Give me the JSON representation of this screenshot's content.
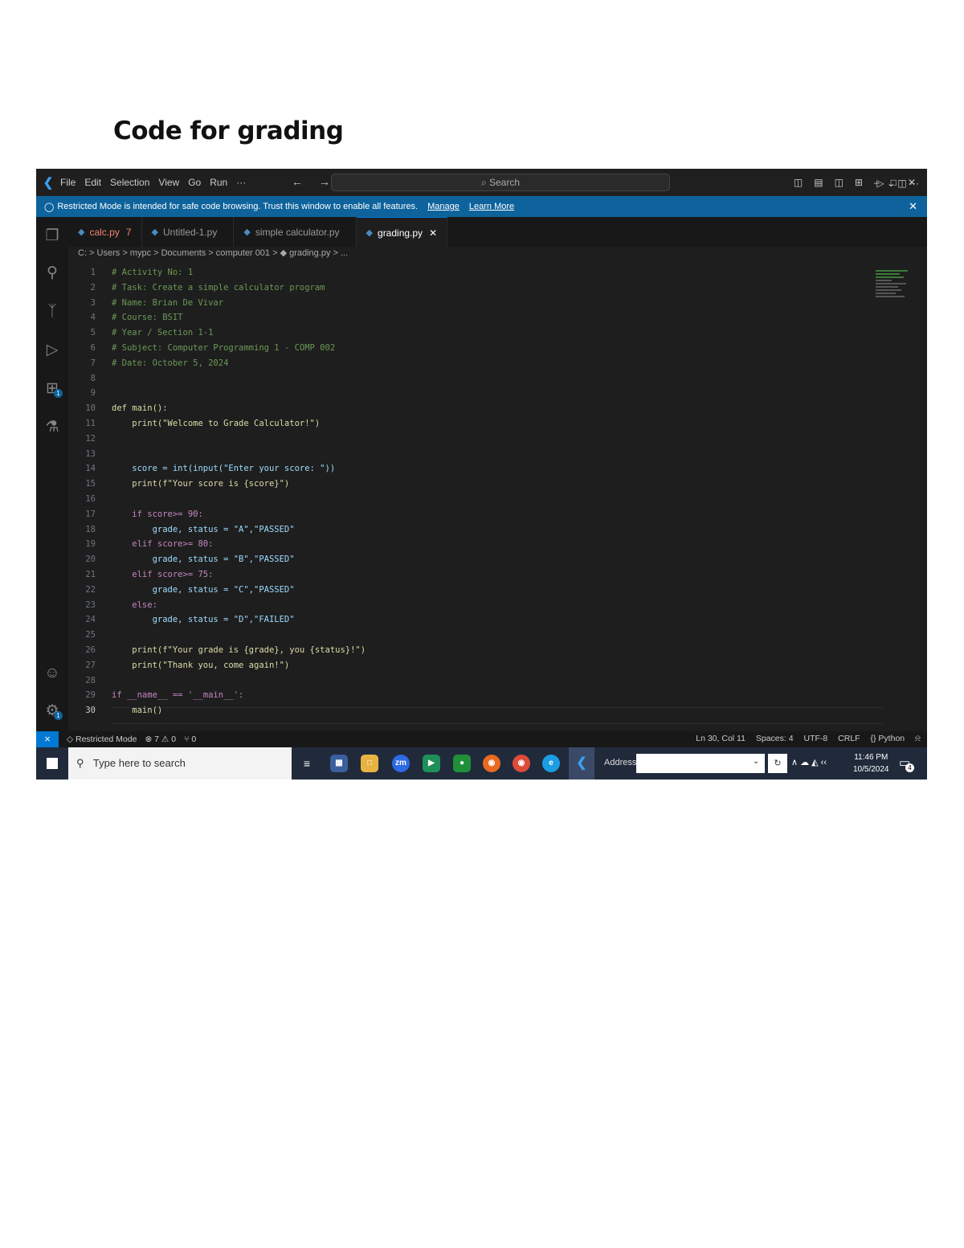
{
  "document": {
    "title": "Code for grading"
  },
  "titlebar": {
    "menu": [
      "File",
      "Edit",
      "Selection",
      "View",
      "Go",
      "Run",
      "···"
    ],
    "nav": "← →",
    "search": "⌕ Search",
    "controls": [
      "◫",
      "▤",
      "◫",
      "⊞",
      "–",
      "□",
      "✕"
    ]
  },
  "banner": {
    "text": "Restricted Mode is intended for safe code browsing. Trust this window to enable all features.",
    "manage": "Manage",
    "learn_more": "Learn More",
    "close": "✕"
  },
  "tabs": [
    {
      "name": "calc.py",
      "suffix": "7"
    },
    {
      "name": "Untitled-1.py",
      "suffix": ""
    },
    {
      "name": "simple calculator.py",
      "suffix": ""
    },
    {
      "name": "grading.py",
      "suffix": "✕"
    }
  ],
  "tab_actions": "▷ ⌄  ◫  ···",
  "breadcrumb": "C: > Users > mypc > Documents > computer 001 > ◆ grading.py > ...",
  "code_lines": [
    {
      "n": "1",
      "t": "# Activity No: 1"
    },
    {
      "n": "2",
      "t": "# Task: Create a simple calculator program"
    },
    {
      "n": "3",
      "t": "# Name: Brian De Vivar"
    },
    {
      "n": "4",
      "t": "# Course: BSIT"
    },
    {
      "n": "5",
      "t": "# Year / Section 1-1"
    },
    {
      "n": "6",
      "t": "# Subject: Computer Programming 1 - COMP 002"
    },
    {
      "n": "7",
      "t": "# Date: October 5, 2024"
    },
    {
      "n": "8",
      "t": ""
    },
    {
      "n": "9",
      "t": ""
    },
    {
      "n": "10",
      "t": "def main():"
    },
    {
      "n": "11",
      "t": "    print(\"Welcome to Grade Calculator!\")"
    },
    {
      "n": "12",
      "t": ""
    },
    {
      "n": "13",
      "t": ""
    },
    {
      "n": "14",
      "t": "    score = int(input(\"Enter your score: \"))"
    },
    {
      "n": "15",
      "t": "    print(f\"Your score is {score}\")"
    },
    {
      "n": "16",
      "t": ""
    },
    {
      "n": "17",
      "t": "    if score>= 90:"
    },
    {
      "n": "18",
      "t": "        grade, status = \"A\",\"PASSED\""
    },
    {
      "n": "19",
      "t": "    elif score>= 80:"
    },
    {
      "n": "20",
      "t": "        grade, status = \"B\",\"PASSED\""
    },
    {
      "n": "21",
      "t": "    elif score>= 75:"
    },
    {
      "n": "22",
      "t": "        grade, status = \"C\",\"PASSED\""
    },
    {
      "n": "23",
      "t": "    else:"
    },
    {
      "n": "24",
      "t": "        grade, status = \"D\",\"FAILED\""
    },
    {
      "n": "25",
      "t": ""
    },
    {
      "n": "26",
      "t": "    print(f\"Your grade is {grade}, you {status}!\")"
    },
    {
      "n": "27",
      "t": "    print(\"Thank you, come again!\")"
    },
    {
      "n": "28",
      "t": ""
    },
    {
      "n": "29",
      "t": "if __name__ == '__main__':"
    },
    {
      "n": "30",
      "t": "    main()"
    }
  ],
  "statusbar": {
    "remote": "⨯",
    "mode": "◇ Restricted Mode",
    "problems": "⊗ 7 ⚠ 0",
    "ports": "⑂ 0",
    "position": "Ln 30, Col 11",
    "spaces": "Spaces: 4",
    "encoding": "UTF-8",
    "eol": "CRLF",
    "language": "{} Python",
    "bell": "⍾"
  },
  "taskbar": {
    "search_placeholder": "Type here to search",
    "address_label": "Address",
    "address_value": "",
    "tray": "∧  ☁  ◭  ‹‹",
    "time": "11:46 PM",
    "date": "10/5/2024",
    "notifications": "4"
  },
  "colors": {
    "comment": "#6a9955",
    "keyword": "#569cd6",
    "control": "#c586c0",
    "function": "#dcdcaa",
    "string": "#ce9178",
    "variable": "#9cdcfe",
    "builtin": "#4ec9b0",
    "number": "#b5cea8"
  }
}
